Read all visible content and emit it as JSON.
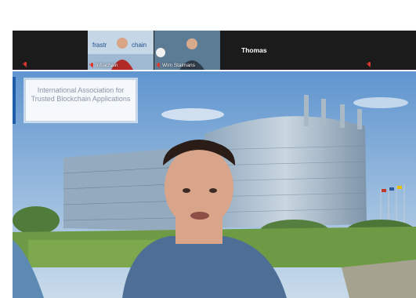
{
  "participants": [
    {
      "name": "Infrachain"
    },
    {
      "name": "Wim Stalmans"
    },
    {
      "name": "Thomas"
    }
  ],
  "background_banner": {
    "text": "International Association for Trusted Blockchain Applications"
  },
  "icons": [
    "mic-muted-icon"
  ],
  "colors": {
    "strip": "#1b1b1b",
    "mic_muted": "#e0382c",
    "banner_text": "#8b95a8"
  }
}
